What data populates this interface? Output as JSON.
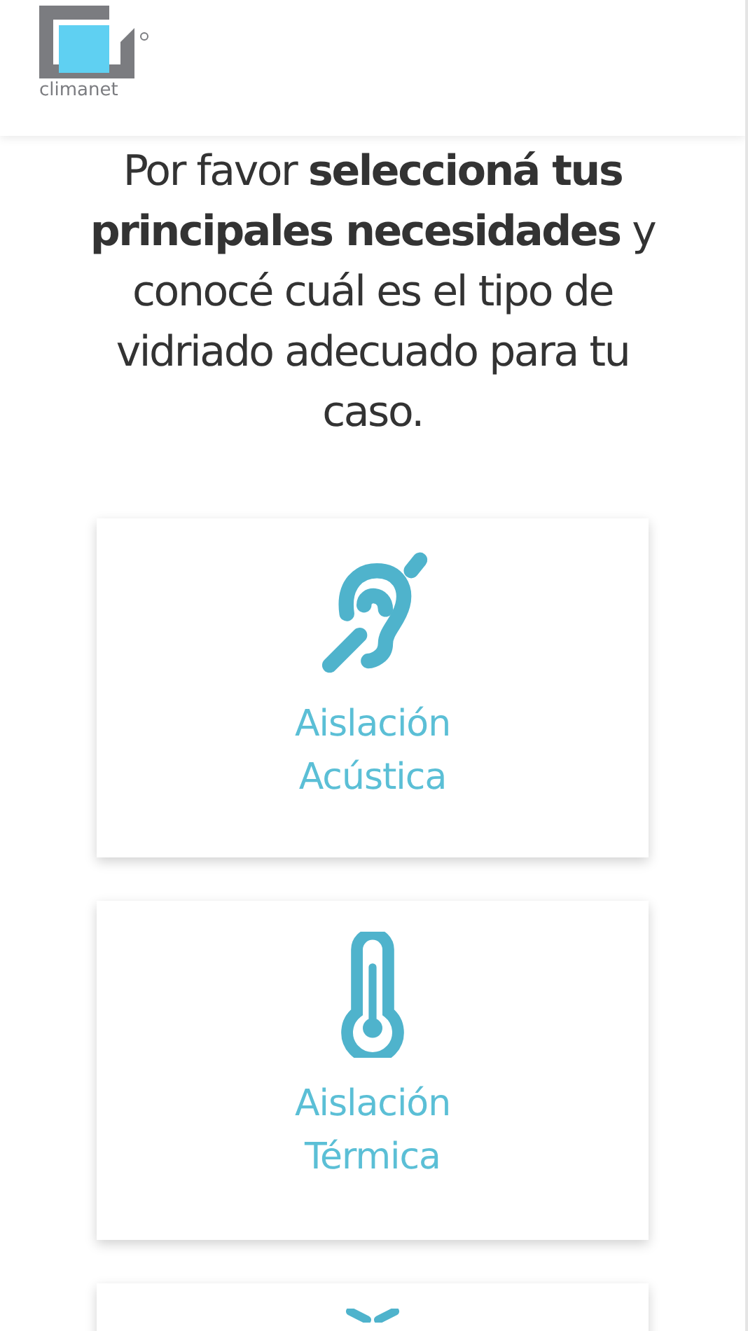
{
  "header": {
    "logo_text": "climanet"
  },
  "intro": "Por favor **seleccioná tus principales necesidades** y conocé cuál es el tipo de vidriado adecuado para tu caso.",
  "options": [
    {
      "kind": "ear",
      "label_lines": [
        "Aislación",
        "Acústica"
      ]
    },
    {
      "kind": "thermometer",
      "label_lines": [
        "Aislación",
        "Térmica"
      ]
    },
    {
      "kind": "bow"
    }
  ]
}
